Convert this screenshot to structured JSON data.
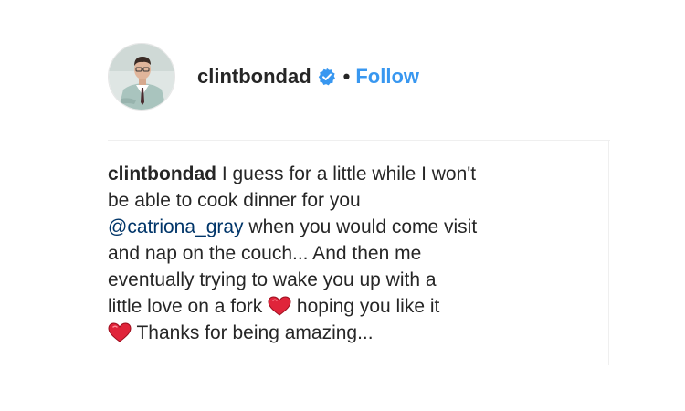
{
  "post": {
    "username": "clintbondad",
    "separator": "•",
    "follow_label": "Follow",
    "verified_icon": "verified-badge-icon",
    "avatar_icon": "avatar-photo"
  },
  "caption": {
    "username": "clintbondad",
    "part1": " I guess for a little while I won't\nbe able to cook dinner for you\n",
    "mention": "@catriona_gray",
    "part2": " when you would come visit\nand nap on the couch... And then me\neventually trying to wake you up with a\nlittle love on a fork ",
    "heart_emoji_1": "❤️",
    "part3": " hoping you like it\n",
    "heart_emoji_2": "❤️",
    "part4": " Thanks for being amazing..."
  },
  "colors": {
    "link_blue": "#3897f0",
    "mention_blue": "#003569",
    "text": "#262626",
    "verified_blue": "#3897f0",
    "heart_red": "#e0243a"
  }
}
